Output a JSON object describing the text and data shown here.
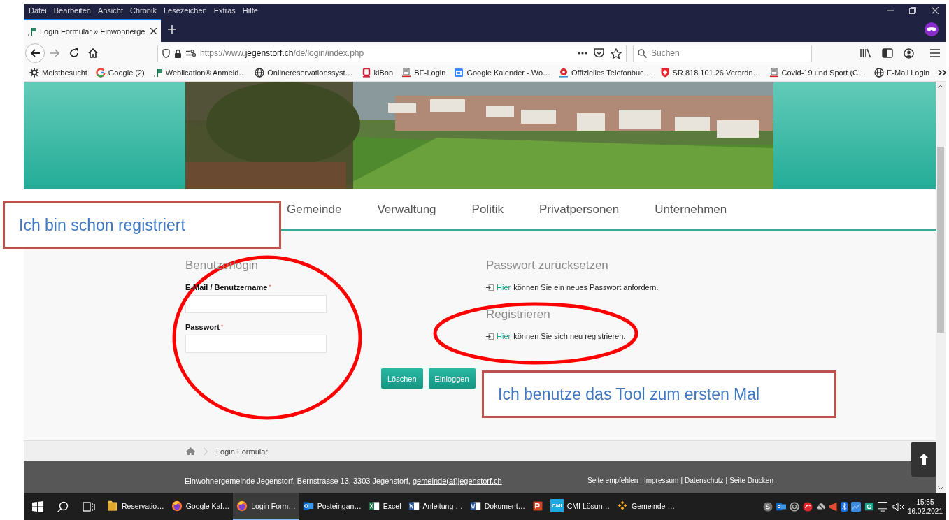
{
  "menu_bar": [
    "Datei",
    "Bearbeiten",
    "Ansicht",
    "Chronik",
    "Lesezeichen",
    "Extras",
    "Hilfe"
  ],
  "tabs": [
    {
      "label": "Login Formular » Einwohnerge",
      "selected": true
    }
  ],
  "address_bar": {
    "url": "https://www.**jegenstorf.ch**/de/login/index.php"
  },
  "search": {
    "placeholder": "Suchen"
  },
  "bookmarks": [
    {
      "label": "Meistbesucht",
      "kind": "gear"
    },
    {
      "label": "Google (2)",
      "kind": "google"
    },
    {
      "label": "Weblication® Anmeld…",
      "kind": "flag"
    },
    {
      "label": "Onlinereservationssyst…",
      "kind": "globe"
    },
    {
      "label": "kiBon",
      "kind": "kibon"
    },
    {
      "label": "BE-Login",
      "kind": "crest"
    },
    {
      "label": "Google Kalender - Wo…",
      "kind": "calendar"
    },
    {
      "label": "Offizielles Telefonbuc…",
      "kind": "pin"
    },
    {
      "label": "SR 818.101.26 Verordn…",
      "kind": "swiss"
    },
    {
      "label": "Covid-19 und Sport (C…",
      "kind": "crest"
    },
    {
      "label": "E-Mail Login",
      "kind": "globe"
    }
  ],
  "site_nav": [
    "Gemeinde",
    "Verwaltung",
    "Politik",
    "Privatpersonen",
    "Unternehmen"
  ],
  "login": {
    "title": "Benutzerlogin",
    "fields": [
      {
        "label": "E-Mail / Benutzername",
        "required_mark": "*"
      },
      {
        "label": "Passwort",
        "required_mark": "*"
      }
    ],
    "buttons": [
      "Löschen",
      "Einloggen"
    ]
  },
  "sections": [
    {
      "title": "Passwort zurücksetzen",
      "link": "Hier",
      "text": "können Sie ein neues Passwort anfordern."
    },
    {
      "title": "Registrieren",
      "link": "Hier",
      "text": "können Sie sich neu registrieren."
    }
  ],
  "breadcrumb": [
    "Login Formular"
  ],
  "footer": {
    "address": "Einwohnergemeinde Jegenstorf, Bernstrasse 13, 3303 Jegenstorf,",
    "email": "gemeinde(at)jegenstorf.ch",
    "links": [
      "Seite empfehlen",
      "Impressum",
      "Datenschutz",
      "Seite Drucken"
    ],
    "separator": "|"
  },
  "taskbar": {
    "apps": [
      {
        "label": "Reservatio…",
        "kind": "folder",
        "selected": false
      },
      {
        "label": "Google Kal…",
        "kind": "firefox",
        "selected": false
      },
      {
        "label": "Login Form…",
        "kind": "firefox",
        "selected": true
      },
      {
        "label": "Posteingan…",
        "kind": "outlook",
        "selected": false
      },
      {
        "label": "Excel",
        "kind": "excel",
        "selected": false
      },
      {
        "label": "Anleitung …",
        "kind": "word",
        "selected": false
      },
      {
        "label": "Dokument…",
        "kind": "word",
        "selected": false
      },
      {
        "kind": "powerpoint",
        "selected": false
      },
      {
        "label": "CMI Lösun…",
        "kind": "cmi",
        "badge": "CMI",
        "selected": false
      },
      {
        "label": "Gemeinde …",
        "kind": "diamonds",
        "selected": false
      }
    ],
    "time": "15:55",
    "date": "16.02.2021"
  },
  "annotations": [
    {
      "text": "Ich bin schon registriert"
    },
    {
      "text": "Ich benutze das Tool zum ersten Mal"
    }
  ]
}
